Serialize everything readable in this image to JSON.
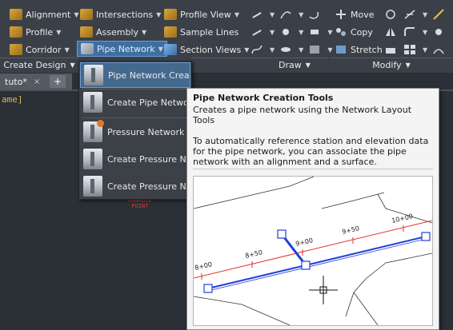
{
  "ribbon": {
    "row1": {
      "alignment": "Alignment",
      "intersections": "Intersections",
      "profile_view": "Profile View",
      "move": "Move"
    },
    "row2": {
      "profile": "Profile",
      "assembly": "Assembly",
      "sample_lines": "Sample Lines",
      "copy": "Copy"
    },
    "row3": {
      "corridor": "Corridor",
      "pipe_network": "Pipe Network",
      "section_views": "Section Views",
      "stretch": "Stretch"
    },
    "panels": {
      "create_design": "Create Design",
      "draw": "Draw",
      "modify": "Modify"
    }
  },
  "drawing_tab": {
    "label": "tuto*",
    "close": "×",
    "add": "+"
  },
  "drawing_text": "ame]",
  "marker": {
    "line1": "MANHOLE",
    "line2": "POINT"
  },
  "menu": {
    "items": [
      {
        "label": "Pipe Network Creation Tools"
      },
      {
        "label": "Create Pipe Network fr"
      },
      {
        "label": "Pressure Network Crea"
      },
      {
        "label": "Create Pressure Netwo"
      },
      {
        "label": "Create Pressure Netwo"
      }
    ]
  },
  "tooltip": {
    "title": "Pipe Network Creation Tools",
    "description": "Creates a pipe network using the Network Layout Tools",
    "detail": "To automatically reference station and elevation data for the pipe network, you can associate the pipe network with an alignment and a surface.",
    "stations": [
      "8+00",
      "8+50",
      "9+00",
      "9+50",
      "10+00"
    ]
  },
  "colors": {
    "alignment": "#e0322d",
    "pipe": "#1f3fd6",
    "ribbon_bg": "#3b4048",
    "active_blue": "#3d6fa3"
  }
}
